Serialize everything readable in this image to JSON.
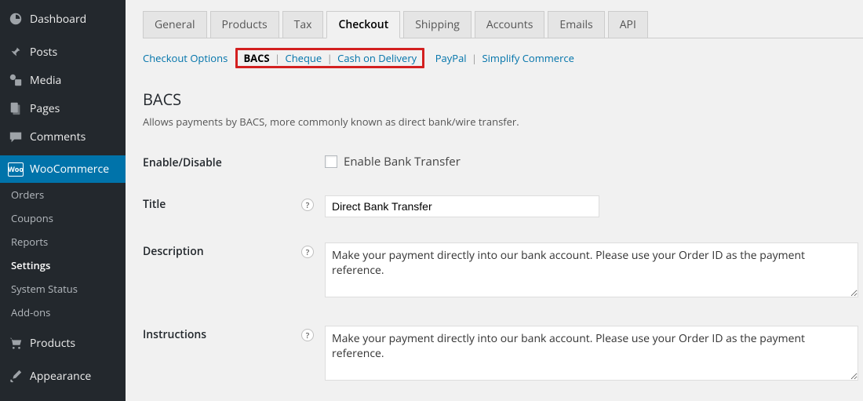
{
  "sidebar": {
    "items": [
      {
        "label": "Dashboard",
        "icon": "dashboard"
      },
      {
        "label": "Posts",
        "icon": "pin"
      },
      {
        "label": "Media",
        "icon": "media"
      },
      {
        "label": "Pages",
        "icon": "pages"
      },
      {
        "label": "Comments",
        "icon": "comments"
      },
      {
        "label": "WooCommerce",
        "icon": "woo",
        "active": true
      },
      {
        "label": "Products",
        "icon": "cart"
      },
      {
        "label": "Appearance",
        "icon": "brush"
      }
    ],
    "sub": [
      {
        "label": "Orders"
      },
      {
        "label": "Coupons"
      },
      {
        "label": "Reports"
      },
      {
        "label": "Settings",
        "current": true
      },
      {
        "label": "System Status"
      },
      {
        "label": "Add-ons"
      }
    ]
  },
  "tabs": [
    "General",
    "Products",
    "Tax",
    "Checkout",
    "Shipping",
    "Accounts",
    "Emails",
    "API"
  ],
  "active_tab": "Checkout",
  "subnav": {
    "pre": "Checkout Options",
    "boxed": [
      "BACS",
      "Cheque",
      "Cash on Delivery"
    ],
    "current": "BACS",
    "post": [
      "PayPal",
      "Simplify Commerce"
    ]
  },
  "page": {
    "heading": "BACS",
    "description": "Allows payments by BACS, more commonly known as direct bank/wire transfer."
  },
  "form": {
    "enable_label": "Enable/Disable",
    "enable_check": "Enable Bank Transfer",
    "title_label": "Title",
    "title_value": "Direct Bank Transfer",
    "desc_label": "Description",
    "desc_value": "Make your payment directly into our bank account. Please use your Order ID as the payment reference.",
    "instr_label": "Instructions",
    "instr_value": "Make your payment directly into our bank account. Please use your Order ID as the payment reference."
  }
}
